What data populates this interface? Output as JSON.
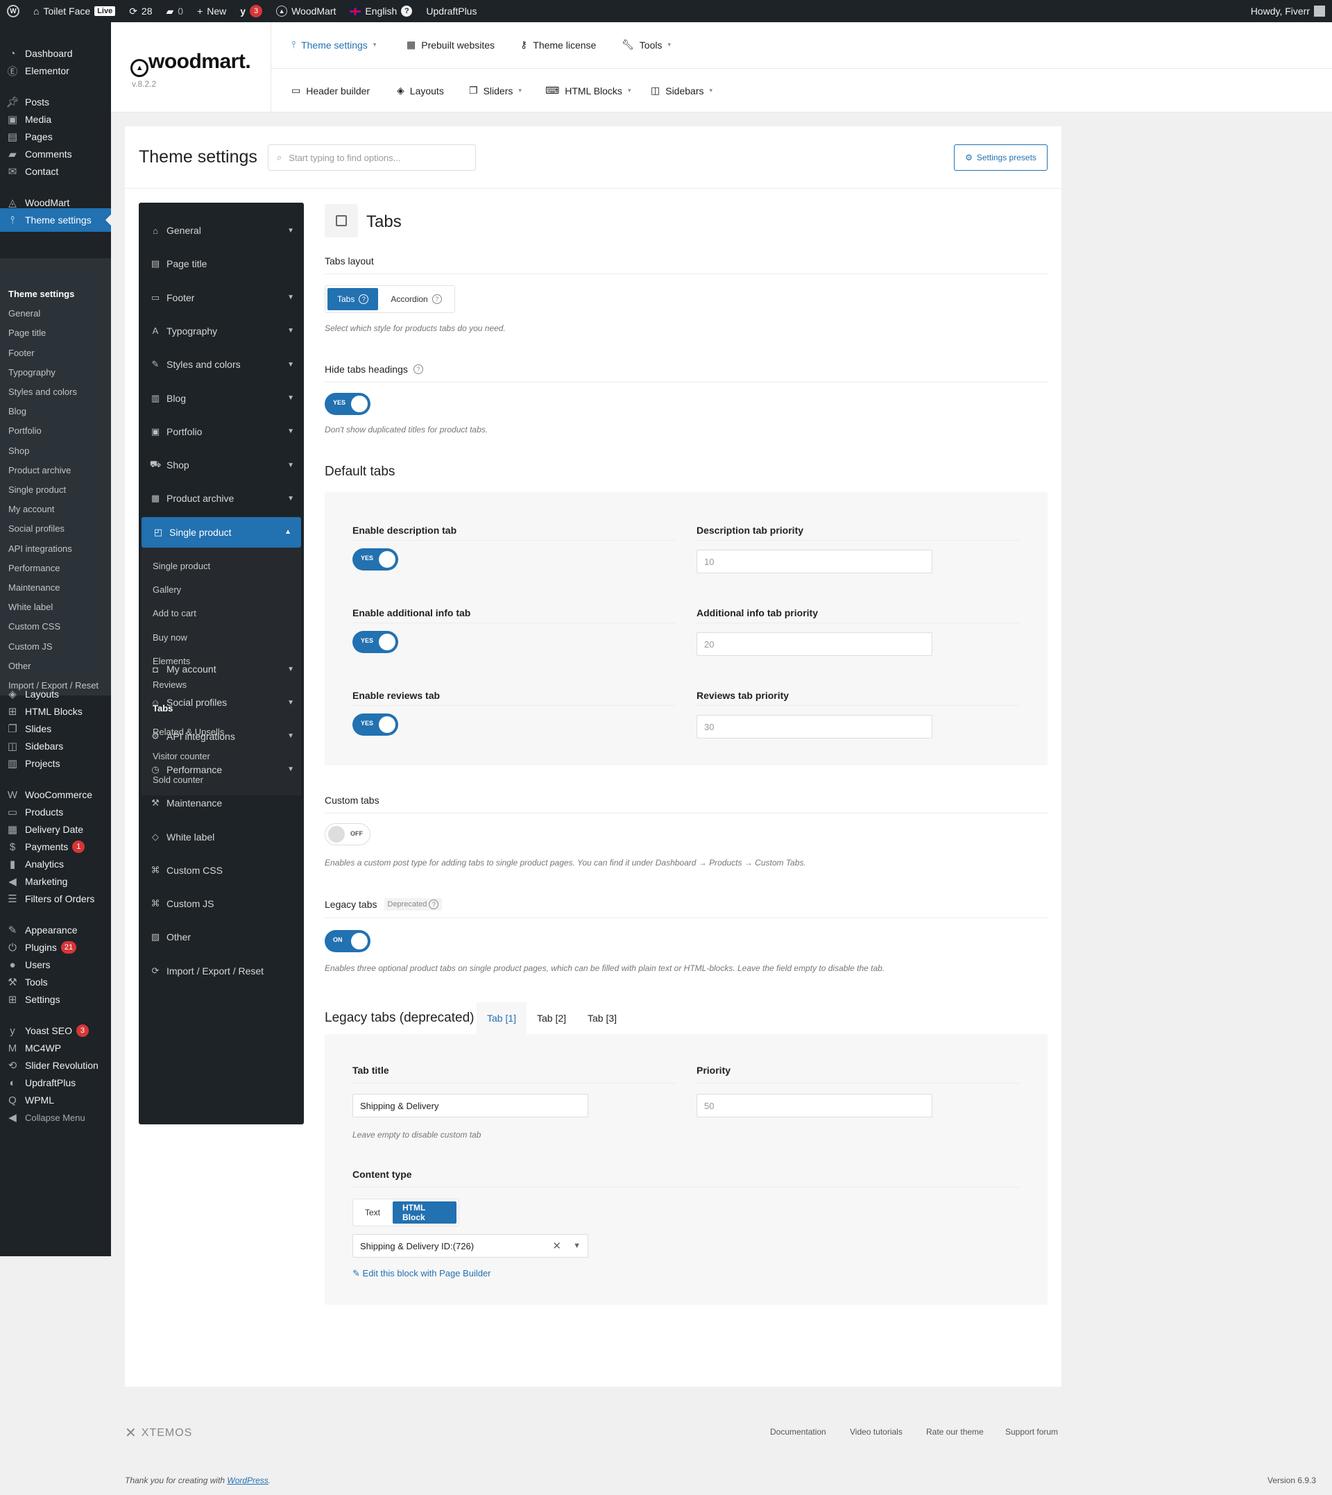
{
  "adminbar": {
    "site_name": "Toilet Face",
    "live_badge": "Live",
    "updates_count": "28",
    "comments_count": "0",
    "new_label": "New",
    "yoast_count": "3",
    "woodmart_label": "WoodMart",
    "language_label": "English",
    "updraft_label": "UpdraftPlus",
    "howdy": "Howdy, Fiverr"
  },
  "adminmenu": {
    "items": [
      {
        "label": "Dashboard",
        "icon": "dashboard-icon"
      },
      {
        "label": "Elementor",
        "icon": "elementor-icon"
      },
      {
        "label": "Posts",
        "icon": "pin-icon"
      },
      {
        "label": "Media",
        "icon": "media-icon"
      },
      {
        "label": "Pages",
        "icon": "page-icon"
      },
      {
        "label": "Comments",
        "icon": "comment-icon"
      },
      {
        "label": "Contact",
        "icon": "mail-icon"
      },
      {
        "label": "WoodMart",
        "icon": "woodmart-icon"
      },
      {
        "label": "Theme settings",
        "icon": "sliders-icon"
      },
      {
        "label": "Layouts",
        "icon": "layers-icon"
      },
      {
        "label": "HTML Blocks",
        "icon": "html-icon"
      },
      {
        "label": "Slides",
        "icon": "slides-icon"
      },
      {
        "label": "Sidebars",
        "icon": "sidebar-icon"
      },
      {
        "label": "Projects",
        "icon": "briefcase-icon"
      },
      {
        "label": "WooCommerce",
        "icon": "woo-icon"
      },
      {
        "label": "Products",
        "icon": "archive-icon"
      },
      {
        "label": "Delivery Date",
        "icon": "calendar-icon"
      },
      {
        "label": "Payments",
        "icon": "dollar-icon"
      },
      {
        "label": "Analytics",
        "icon": "chart-icon"
      },
      {
        "label": "Marketing",
        "icon": "megaphone-icon"
      },
      {
        "label": "Filters of Orders",
        "icon": "list-icon"
      },
      {
        "label": "Appearance",
        "icon": "brush-icon"
      },
      {
        "label": "Plugins",
        "icon": "plug-icon"
      },
      {
        "label": "Users",
        "icon": "user-icon"
      },
      {
        "label": "Tools",
        "icon": "wrench-icon"
      },
      {
        "label": "Settings",
        "icon": "settings-icon"
      },
      {
        "label": "Yoast SEO",
        "icon": "yoast-icon"
      },
      {
        "label": "MC4WP",
        "icon": "mc4wp-icon"
      },
      {
        "label": "Slider Revolution",
        "icon": "revolution-icon"
      },
      {
        "label": "UpdraftPlus",
        "icon": "updraft-icon"
      },
      {
        "label": "WPML",
        "icon": "wpml-icon"
      },
      {
        "label": "Collapse Menu",
        "icon": "collapse-icon"
      }
    ],
    "payments_badge": "1",
    "plugins_badge": "21",
    "yoast_badge": "3",
    "submenu": [
      "Theme settings",
      "General",
      "Page title",
      "Footer",
      "Typography",
      "Styles and colors",
      "Blog",
      "Portfolio",
      "Shop",
      "Product archive",
      "Single product",
      "My account",
      "Social profiles",
      "API integrations",
      "Performance",
      "Maintenance",
      "White label",
      "Custom CSS",
      "Custom JS",
      "Other",
      "Import / Export / Reset"
    ]
  },
  "topnav": {
    "logo": "woodmart.",
    "version": "v.8.2.2",
    "row1": [
      "Theme settings",
      "Prebuilt websites",
      "Theme license",
      "Tools"
    ],
    "row2": [
      "Header builder",
      "Layouts",
      "Sliders",
      "HTML Blocks",
      "Sidebars"
    ]
  },
  "panel": {
    "title": "Theme settings",
    "search_placeholder": "Start typing to find options...",
    "presets_label": "Settings presets"
  },
  "settings_nav": {
    "items": [
      "General",
      "Page title",
      "Footer",
      "Typography",
      "Styles and colors",
      "Blog",
      "Portfolio",
      "Shop",
      "Product archive",
      "Single product",
      "My account",
      "Social profiles",
      "API integrations",
      "Performance",
      "Maintenance",
      "White label",
      "Custom CSS",
      "Custom JS",
      "Other",
      "Import / Export / Reset"
    ],
    "sub_items": [
      "Single product",
      "Gallery",
      "Add to cart",
      "Buy now",
      "Elements",
      "Reviews",
      "Tabs",
      "Related & Upsells",
      "Visitor counter",
      "Sold counter"
    ]
  },
  "content": {
    "section_title": "Tabs",
    "tabs_layout": {
      "label": "Tabs layout",
      "options": [
        "Tabs",
        "Accordion"
      ],
      "selected": "Tabs",
      "desc": "Select which style for products tabs do you need."
    },
    "hide_headings": {
      "label": "Hide tabs headings",
      "toggle": "YES",
      "desc": "Don't show duplicated titles for product tabs."
    },
    "default_tabs": {
      "title": "Default tabs",
      "rows": [
        {
          "label": "Enable description tab",
          "toggle": "YES",
          "priority_label": "Description tab priority",
          "priority": "10"
        },
        {
          "label": "Enable additional info tab",
          "toggle": "YES",
          "priority_label": "Additional info tab priority",
          "priority": "20"
        },
        {
          "label": "Enable reviews tab",
          "toggle": "YES",
          "priority_label": "Reviews tab priority",
          "priority": "30"
        }
      ]
    },
    "custom_tabs": {
      "label": "Custom tabs",
      "toggle": "OFF",
      "desc": "Enables a custom post type for adding tabs to single product pages. You can find it under Dashboard → Products → Custom Tabs."
    },
    "legacy_tabs": {
      "label": "Legacy tabs",
      "badge": "Deprecated",
      "toggle": "ON",
      "desc": "Enables three optional product tabs on single product pages, which can be filled with plain text or HTML-blocks. Leave the field empty to disable the tab."
    },
    "legacy_section": {
      "title": "Legacy tabs (deprecated)",
      "tabs": [
        "Tab [1]",
        "Tab [2]",
        "Tab [3]"
      ],
      "tab_title_label": "Tab title",
      "tab_title_value": "Shipping & Delivery",
      "tab_title_desc": "Leave empty to disable custom tab",
      "priority_label": "Priority",
      "priority_value": "50",
      "content_type_label": "Content type",
      "content_types": [
        "Text",
        "HTML Block"
      ],
      "content_type_selected": "HTML Block",
      "block_select": "Shipping & Delivery ID:(726)",
      "edit_link": "Edit this block with Page Builder"
    }
  },
  "footer": {
    "brand": "XTEMOS",
    "links": [
      "Documentation",
      "Video tutorials",
      "Rate our theme",
      "Support forum"
    ],
    "thanks_prefix": "Thank you for creating with ",
    "thanks_link": "WordPress",
    "thanks_suffix": ".",
    "version": "Version 6.9.3"
  },
  "colors": {
    "accent": "#2271b1",
    "admin_bg": "#1d2327",
    "panel_bg": "#ffffff",
    "page_bg": "#f0f0f1"
  }
}
